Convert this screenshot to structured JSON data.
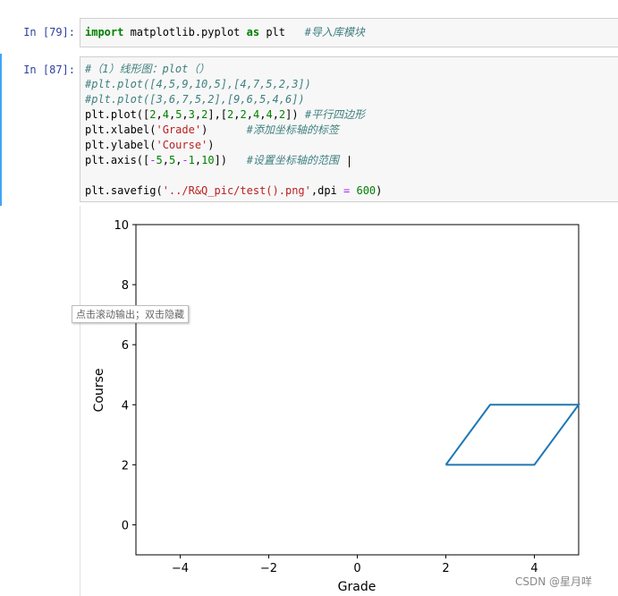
{
  "cells": [
    {
      "prompt": "In  [79]:",
      "lines": [
        [
          {
            "t": "import",
            "c": "kw"
          },
          {
            "t": " matplotlib.pyplot ",
            "c": ""
          },
          {
            "t": "as",
            "c": "kw"
          },
          {
            "t": " plt   ",
            "c": ""
          },
          {
            "t": "#导入库模块",
            "c": "cm"
          }
        ]
      ]
    },
    {
      "prompt": "In  [87]:",
      "lines": [
        [
          {
            "t": "#（1）线形图：plot（）",
            "c": "cm"
          }
        ],
        [
          {
            "t": "#plt.plot([4,5,9,10,5],[4,7,5,2,3])",
            "c": "cm"
          }
        ],
        [
          {
            "t": "#plt.plot([3,6,7,5,2],[9,6,5,4,6])",
            "c": "cm"
          }
        ],
        [
          {
            "t": "plt.plot([",
            "c": ""
          },
          {
            "t": "2",
            "c": "num"
          },
          {
            "t": ",",
            "c": ""
          },
          {
            "t": "4",
            "c": "num"
          },
          {
            "t": ",",
            "c": ""
          },
          {
            "t": "5",
            "c": "num"
          },
          {
            "t": ",",
            "c": ""
          },
          {
            "t": "3",
            "c": "num"
          },
          {
            "t": ",",
            "c": ""
          },
          {
            "t": "2",
            "c": "num"
          },
          {
            "t": "],[",
            "c": ""
          },
          {
            "t": "2",
            "c": "num"
          },
          {
            "t": ",",
            "c": ""
          },
          {
            "t": "2",
            "c": "num"
          },
          {
            "t": ",",
            "c": ""
          },
          {
            "t": "4",
            "c": "num"
          },
          {
            "t": ",",
            "c": ""
          },
          {
            "t": "4",
            "c": "num"
          },
          {
            "t": ",",
            "c": ""
          },
          {
            "t": "2",
            "c": "num"
          },
          {
            "t": "]) ",
            "c": ""
          },
          {
            "t": "#平行四边形",
            "c": "cm"
          }
        ],
        [
          {
            "t": "plt.xlabel(",
            "c": ""
          },
          {
            "t": "'Grade'",
            "c": "str"
          },
          {
            "t": ")      ",
            "c": ""
          },
          {
            "t": "#添加坐标轴的标签",
            "c": "cm"
          }
        ],
        [
          {
            "t": "plt.ylabel(",
            "c": ""
          },
          {
            "t": "'Course'",
            "c": "str"
          },
          {
            "t": ")",
            "c": ""
          }
        ],
        [
          {
            "t": "plt.axis([",
            "c": ""
          },
          {
            "t": "-",
            "c": "op"
          },
          {
            "t": "5",
            "c": "num"
          },
          {
            "t": ",",
            "c": ""
          },
          {
            "t": "5",
            "c": "num"
          },
          {
            "t": ",",
            "c": ""
          },
          {
            "t": "-",
            "c": "op"
          },
          {
            "t": "1",
            "c": "num"
          },
          {
            "t": ",",
            "c": ""
          },
          {
            "t": "10",
            "c": "num"
          },
          {
            "t": "])   ",
            "c": ""
          },
          {
            "t": "#设置坐标轴的范围",
            "c": "cm"
          }
        ],
        [],
        [
          {
            "t": "plt.savefig(",
            "c": ""
          },
          {
            "t": "'../R&Q_pic/test().png'",
            "c": "str"
          },
          {
            "t": ",dpi ",
            "c": ""
          },
          {
            "t": "=",
            "c": "op"
          },
          {
            "t": " ",
            "c": ""
          },
          {
            "t": "600",
            "c": "num"
          },
          {
            "t": ")",
            "c": ""
          }
        ]
      ]
    }
  ],
  "tooltip": "点击滚动输出；双击隐藏",
  "watermark": "CSDN @星月咩",
  "colors": {
    "line": "#1f77b4",
    "prompt": "#303f9f",
    "comment": "#408080"
  },
  "chart_data": {
    "type": "line",
    "x": [
      2,
      4,
      5,
      3,
      2
    ],
    "y": [
      2,
      2,
      4,
      4,
      2
    ],
    "xlabel": "Grade",
    "ylabel": "Course",
    "xlim": [
      -5,
      5
    ],
    "ylim": [
      -1,
      10
    ],
    "xticks": [
      -4,
      -2,
      0,
      2,
      4
    ],
    "yticks": [
      0,
      2,
      4,
      6,
      8,
      10
    ],
    "xtick_labels": [
      "−4",
      "−2",
      "0",
      "2",
      "4"
    ],
    "ytick_labels": [
      "0",
      "2",
      "4",
      "6",
      "8",
      "10"
    ],
    "grid": false
  }
}
